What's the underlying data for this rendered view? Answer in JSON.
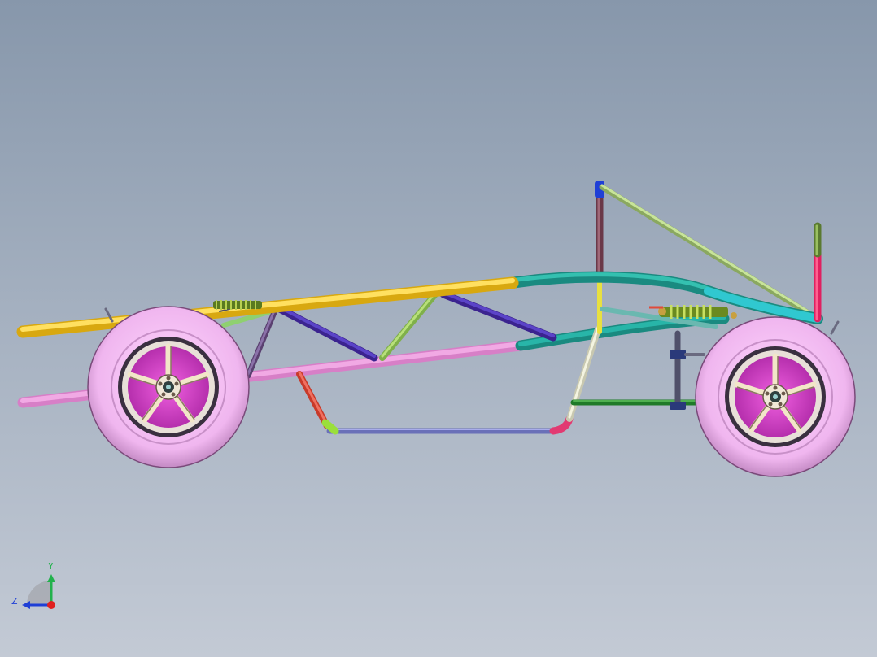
{
  "viewport": {
    "background_top": "#8797ab",
    "background_bottom": "#c3cad5"
  },
  "triad": {
    "x_label": "",
    "y_label": "Y",
    "z_label": "Z",
    "y_color": "#22b14c",
    "z_color": "#1f3fd6",
    "origin_color": "#e02020"
  },
  "model": {
    "tire_color": "#f0b6ef",
    "rim_color": "#d83fd0",
    "spoke_color": "#f2e6c8",
    "colors": {
      "yellow": "#f3c928",
      "pink": "#e58bd3",
      "teal": "#1c9e90",
      "purple": "#4a2fb0",
      "green": "#9ccf5a",
      "olive": "#a7c06a",
      "dark_green": "#1f7a28",
      "blue_grey": "#7a7fc8",
      "red": "#e04a3a",
      "magenta": "#e23a72",
      "cyan": "#2fc8c8",
      "maroon": "#7a3a4a",
      "spring": "#8fa840"
    }
  }
}
